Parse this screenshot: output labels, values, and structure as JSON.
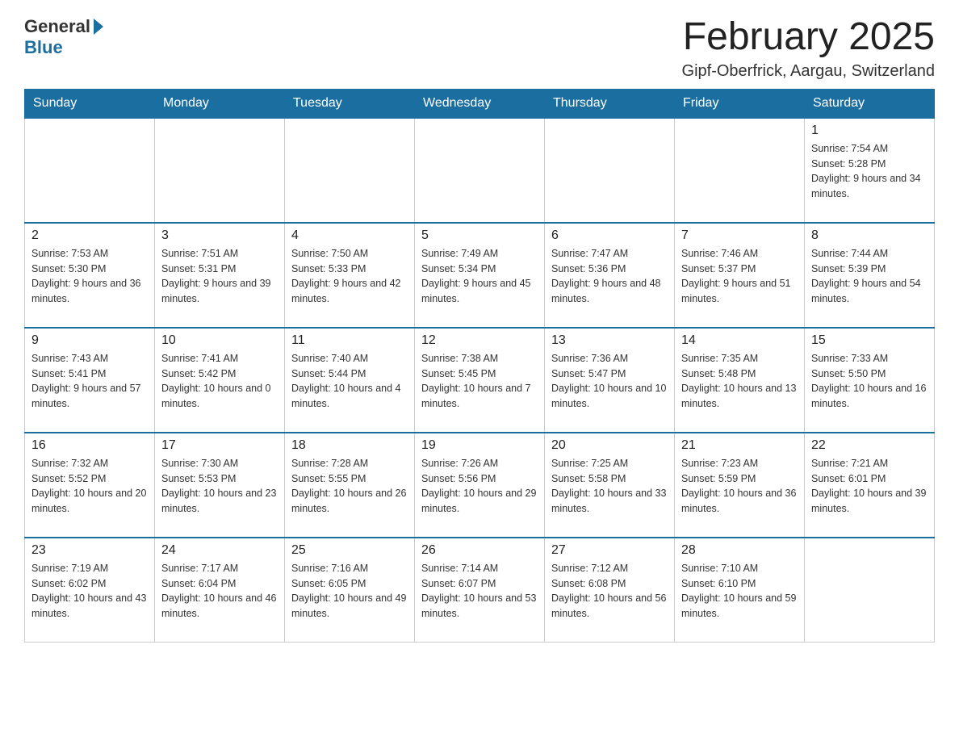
{
  "logo": {
    "general": "General",
    "blue": "Blue"
  },
  "title": "February 2025",
  "location": "Gipf-Oberfrick, Aargau, Switzerland",
  "days_of_week": [
    "Sunday",
    "Monday",
    "Tuesday",
    "Wednesday",
    "Thursday",
    "Friday",
    "Saturday"
  ],
  "weeks": [
    [
      {
        "day": "",
        "info": ""
      },
      {
        "day": "",
        "info": ""
      },
      {
        "day": "",
        "info": ""
      },
      {
        "day": "",
        "info": ""
      },
      {
        "day": "",
        "info": ""
      },
      {
        "day": "",
        "info": ""
      },
      {
        "day": "1",
        "info": "Sunrise: 7:54 AM\nSunset: 5:28 PM\nDaylight: 9 hours and 34 minutes."
      }
    ],
    [
      {
        "day": "2",
        "info": "Sunrise: 7:53 AM\nSunset: 5:30 PM\nDaylight: 9 hours and 36 minutes."
      },
      {
        "day": "3",
        "info": "Sunrise: 7:51 AM\nSunset: 5:31 PM\nDaylight: 9 hours and 39 minutes."
      },
      {
        "day": "4",
        "info": "Sunrise: 7:50 AM\nSunset: 5:33 PM\nDaylight: 9 hours and 42 minutes."
      },
      {
        "day": "5",
        "info": "Sunrise: 7:49 AM\nSunset: 5:34 PM\nDaylight: 9 hours and 45 minutes."
      },
      {
        "day": "6",
        "info": "Sunrise: 7:47 AM\nSunset: 5:36 PM\nDaylight: 9 hours and 48 minutes."
      },
      {
        "day": "7",
        "info": "Sunrise: 7:46 AM\nSunset: 5:37 PM\nDaylight: 9 hours and 51 minutes."
      },
      {
        "day": "8",
        "info": "Sunrise: 7:44 AM\nSunset: 5:39 PM\nDaylight: 9 hours and 54 minutes."
      }
    ],
    [
      {
        "day": "9",
        "info": "Sunrise: 7:43 AM\nSunset: 5:41 PM\nDaylight: 9 hours and 57 minutes."
      },
      {
        "day": "10",
        "info": "Sunrise: 7:41 AM\nSunset: 5:42 PM\nDaylight: 10 hours and 0 minutes."
      },
      {
        "day": "11",
        "info": "Sunrise: 7:40 AM\nSunset: 5:44 PM\nDaylight: 10 hours and 4 minutes."
      },
      {
        "day": "12",
        "info": "Sunrise: 7:38 AM\nSunset: 5:45 PM\nDaylight: 10 hours and 7 minutes."
      },
      {
        "day": "13",
        "info": "Sunrise: 7:36 AM\nSunset: 5:47 PM\nDaylight: 10 hours and 10 minutes."
      },
      {
        "day": "14",
        "info": "Sunrise: 7:35 AM\nSunset: 5:48 PM\nDaylight: 10 hours and 13 minutes."
      },
      {
        "day": "15",
        "info": "Sunrise: 7:33 AM\nSunset: 5:50 PM\nDaylight: 10 hours and 16 minutes."
      }
    ],
    [
      {
        "day": "16",
        "info": "Sunrise: 7:32 AM\nSunset: 5:52 PM\nDaylight: 10 hours and 20 minutes."
      },
      {
        "day": "17",
        "info": "Sunrise: 7:30 AM\nSunset: 5:53 PM\nDaylight: 10 hours and 23 minutes."
      },
      {
        "day": "18",
        "info": "Sunrise: 7:28 AM\nSunset: 5:55 PM\nDaylight: 10 hours and 26 minutes."
      },
      {
        "day": "19",
        "info": "Sunrise: 7:26 AM\nSunset: 5:56 PM\nDaylight: 10 hours and 29 minutes."
      },
      {
        "day": "20",
        "info": "Sunrise: 7:25 AM\nSunset: 5:58 PM\nDaylight: 10 hours and 33 minutes."
      },
      {
        "day": "21",
        "info": "Sunrise: 7:23 AM\nSunset: 5:59 PM\nDaylight: 10 hours and 36 minutes."
      },
      {
        "day": "22",
        "info": "Sunrise: 7:21 AM\nSunset: 6:01 PM\nDaylight: 10 hours and 39 minutes."
      }
    ],
    [
      {
        "day": "23",
        "info": "Sunrise: 7:19 AM\nSunset: 6:02 PM\nDaylight: 10 hours and 43 minutes."
      },
      {
        "day": "24",
        "info": "Sunrise: 7:17 AM\nSunset: 6:04 PM\nDaylight: 10 hours and 46 minutes."
      },
      {
        "day": "25",
        "info": "Sunrise: 7:16 AM\nSunset: 6:05 PM\nDaylight: 10 hours and 49 minutes."
      },
      {
        "day": "26",
        "info": "Sunrise: 7:14 AM\nSunset: 6:07 PM\nDaylight: 10 hours and 53 minutes."
      },
      {
        "day": "27",
        "info": "Sunrise: 7:12 AM\nSunset: 6:08 PM\nDaylight: 10 hours and 56 minutes."
      },
      {
        "day": "28",
        "info": "Sunrise: 7:10 AM\nSunset: 6:10 PM\nDaylight: 10 hours and 59 minutes."
      },
      {
        "day": "",
        "info": ""
      }
    ]
  ]
}
